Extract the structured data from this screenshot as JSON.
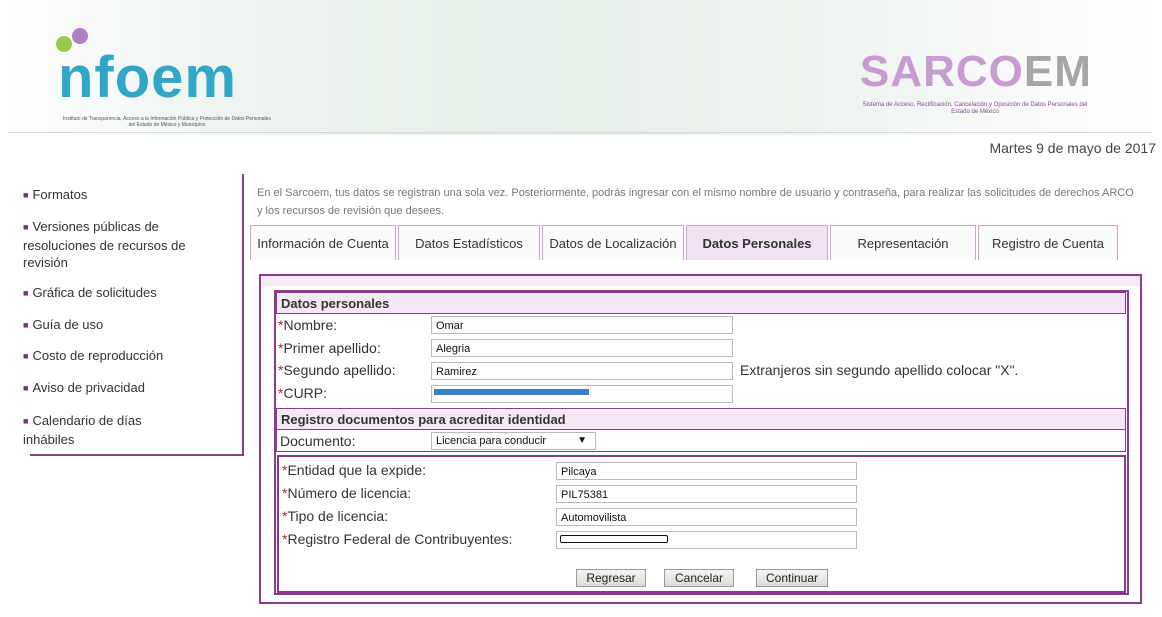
{
  "header": {
    "logo_left": {
      "word": "nfoem",
      "subtitle": "Instituto de Transparencia, Acceso a la Información Pública y Protección de Datos Personales del Estado de México y Municipios"
    },
    "logo_right": {
      "word_part1": "SARCO",
      "word_part2": "EM",
      "subtitle": "Sistema de Acceso, Rectificación, Cancelación y Oposición de Datos Personales del Estado de México"
    },
    "date": "Martes 9 de mayo de 2017"
  },
  "sidebar": {
    "items": [
      {
        "label": "Formatos"
      },
      {
        "label": "Versiones públicas de resoluciones de recursos de revisión"
      },
      {
        "label": "Gráfica de solicitudes"
      },
      {
        "label": "Guía de uso"
      },
      {
        "label": "Costo de reproducción"
      },
      {
        "label": "Aviso de privacidad"
      },
      {
        "label": "Calendario de días inhábiles"
      }
    ]
  },
  "intro_text": "En el Sarcoem, tus datos se registran una sola vez. Posteriormente, podrás ingresar con el mismo nombre de usuario y contraseña, para realizar las solicitudes de derechos ARCO y los recursos de revisión que desees.",
  "tabs": [
    {
      "label": "Información de Cuenta",
      "active": false
    },
    {
      "label": "Datos Estadísticos",
      "active": false
    },
    {
      "label": "Datos de Localización",
      "active": false
    },
    {
      "label": "Datos Personales",
      "active": true
    },
    {
      "label": "Representación",
      "active": false
    },
    {
      "label": "Registro de Cuenta",
      "active": false
    }
  ],
  "form": {
    "section_personal": "Datos personales",
    "nombre": {
      "label": "Nombre:",
      "value": "Omar"
    },
    "primer_apellido": {
      "label": "Primer apellido:",
      "value": "Alegria"
    },
    "segundo_apellido": {
      "label": "Segundo apellido:",
      "value": "Ramirez"
    },
    "segundo_apellido_note": "Extranjeros sin segundo apellido colocar \"X\".",
    "curp": {
      "label": "CURP:",
      "value": ""
    },
    "section_docs": "Registro documentos para acreditar identidad",
    "documento": {
      "label": "Documento:",
      "selected": "Licencia para conducir"
    },
    "entidad": {
      "label": "Entidad que la expide:",
      "value": "Pilcaya"
    },
    "numero_licencia": {
      "label": "Número de licencia:",
      "value": "PIL75381"
    },
    "tipo_licencia": {
      "label": "Tipo de licencia:",
      "value": "Automovilista"
    },
    "rfc": {
      "label": "Registro Federal de Contribuyentes:",
      "value": ""
    },
    "required_mark": "*"
  },
  "buttons": {
    "regresar": "Regresar",
    "cancelar": "Cancelar",
    "continuar": "Continuar"
  },
  "colors": {
    "accent": "#8c3a8e",
    "section_bg": "#f3e8f4",
    "required": "#c0202a"
  }
}
